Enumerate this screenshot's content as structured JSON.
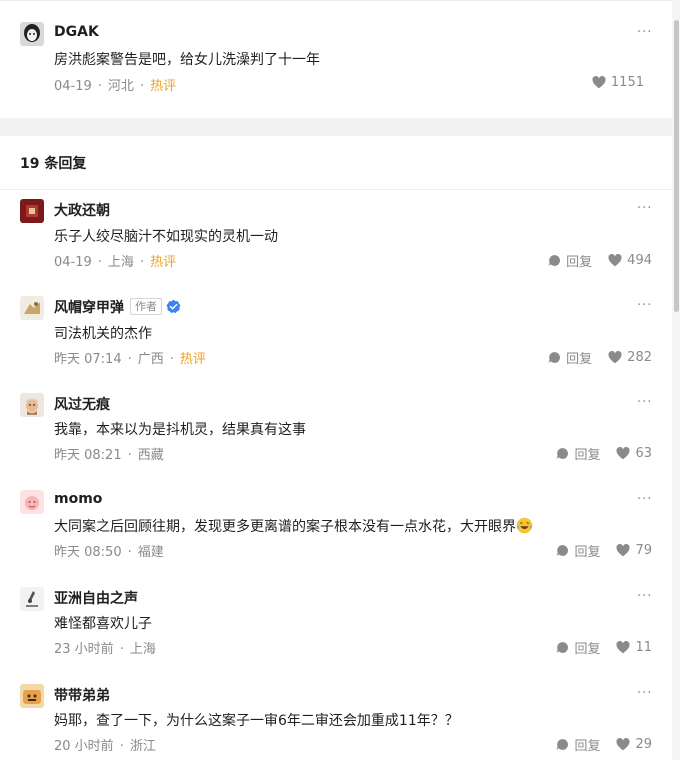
{
  "main_comment": {
    "username": "DGAK",
    "text": "房洪彪案警告是吧，给女儿洗澡判了十一年",
    "date": "04-19",
    "location": "河北",
    "hot": "热评",
    "likes": "1151"
  },
  "replies_header": "19 条回复",
  "reply_label": "回复",
  "replies": [
    {
      "username": "大政还朝",
      "text": "乐子人绞尽脑汁不如现实的灵机一动",
      "date": "04-19",
      "location": "上海",
      "hot": "热评",
      "likes": "494"
    },
    {
      "username": "风帽穿甲弹",
      "author_tag": "作者",
      "text": "司法机关的杰作",
      "date": "昨天 07:14",
      "location": "广西",
      "hot": "热评",
      "likes": "282"
    },
    {
      "username": "风过无痕",
      "text": "我靠，本来以为是抖机灵，结果真有这事",
      "date": "昨天 08:21",
      "location": "西藏",
      "likes": "63"
    },
    {
      "username": "momo",
      "text": "大同案之后回顾往期，发现更多更离谱的案子根本没有一点水花，大开眼界",
      "date": "昨天 08:50",
      "location": "福建",
      "likes": "79"
    },
    {
      "username": "亚洲自由之声",
      "text": "难怪都喜欢儿子",
      "date": "23 小时前",
      "location": "上海",
      "likes": "11"
    },
    {
      "username": "带带弟弟",
      "text": "妈耶，查了一下，为什么这案子一审6年二审还会加重成11年？？",
      "date": "20 小时前",
      "location": "浙江",
      "likes": "29"
    }
  ],
  "icons": {
    "more": "more-horizontal-icon",
    "reply": "comment-bubble-icon",
    "like": "heart-icon",
    "verified": "verified-badge-icon",
    "emoji": "laughing-tears-emoji-icon"
  },
  "colors": {
    "hot": "#f0a020",
    "meta": "#8a8a8a",
    "verified": "#3b82f6",
    "divider": "#f2f2f4"
  }
}
